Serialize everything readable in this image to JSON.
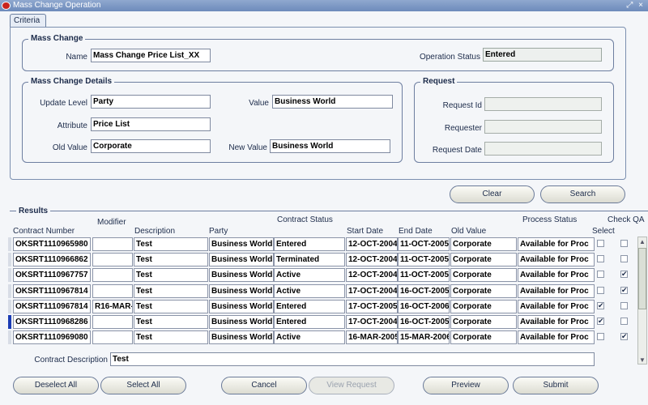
{
  "window": {
    "title": "Mass Change Operation",
    "controls": "⤢ ×"
  },
  "tab": {
    "label": "Criteria"
  },
  "mass_change": {
    "group_label": "Mass Change",
    "name_label": "Name",
    "name_value": "Mass Change Price List_XX",
    "status_label": "Operation Status",
    "status_value": "Entered"
  },
  "details": {
    "group_label": "Mass Change Details",
    "update_level_label": "Update Level",
    "update_level_value": "Party",
    "attribute_label": "Attribute",
    "attribute_value": "Price List",
    "old_value_label": "Old Value",
    "old_value_value": "Corporate",
    "value_label": "Value",
    "value_value": "Business World",
    "new_value_label": "New Value",
    "new_value_value": "Business World"
  },
  "request": {
    "group_label": "Request",
    "id_label": "Request Id",
    "requester_label": "Requester",
    "date_label": "Request Date",
    "id_value": "",
    "requester_value": "",
    "date_value": ""
  },
  "buttons": {
    "clear": "Clear",
    "search": "Search",
    "deselect_all": "Deselect All",
    "select_all": "Select All",
    "cancel": "Cancel",
    "view_request": "View Request",
    "preview": "Preview",
    "submit": "Submit"
  },
  "results": {
    "label": "Results",
    "headers": {
      "contract_number": "Contract Number",
      "modifier": "Modifier",
      "description": "Description",
      "party": "Party",
      "contract_status": "Contract Status",
      "start_date": "Start Date",
      "end_date": "End Date",
      "old_value": "Old Value",
      "process_status": "Process Status",
      "select": "Select",
      "check_qa": "Check QA"
    },
    "rows": [
      {
        "contract": "OKSRT1110965980",
        "modifier": "",
        "description": "Test",
        "party": "Business World",
        "status": "Entered",
        "start": "12-OCT-2004",
        "end": "11-OCT-2005",
        "old_value": "Corporate",
        "process": "Available for Proc",
        "select": false,
        "qa": false
      },
      {
        "contract": "OKSRT1110966862",
        "modifier": "",
        "description": "Test",
        "party": "Business World",
        "status": "Terminated",
        "start": "12-OCT-2004",
        "end": "11-OCT-2005",
        "old_value": "Corporate",
        "process": "Available for Proc",
        "select": false,
        "qa": false
      },
      {
        "contract": "OKSRT1110967757",
        "modifier": "",
        "description": "Test",
        "party": "Business World",
        "status": "Active",
        "start": "12-OCT-2004",
        "end": "11-OCT-2005",
        "old_value": "Corporate",
        "process": "Available for Proc",
        "select": false,
        "qa": true
      },
      {
        "contract": "OKSRT1110967814",
        "modifier": "",
        "description": "Test",
        "party": "Business World",
        "status": "Active",
        "start": "17-OCT-2004",
        "end": "16-OCT-2005",
        "old_value": "Corporate",
        "process": "Available for Proc",
        "select": false,
        "qa": true
      },
      {
        "contract": "OKSRT1110967814",
        "modifier": "R16-MAR-",
        "description": "Test",
        "party": "Business World",
        "status": "Entered",
        "start": "17-OCT-2005",
        "end": "16-OCT-2006",
        "old_value": "Corporate",
        "process": "Available for Proc",
        "select": true,
        "qa": false
      },
      {
        "contract": "OKSRT1110968286",
        "modifier": "",
        "description": "Test",
        "party": "Business World",
        "status": "Entered",
        "start": "17-OCT-2004",
        "end": "16-OCT-2005",
        "old_value": "Corporate",
        "process": "Available for Proc",
        "select": true,
        "qa": false
      },
      {
        "contract": "OKSRT1110969080",
        "modifier": "",
        "description": "Test",
        "party": "Business World",
        "status": "Active",
        "start": "16-MAR-2005",
        "end": "15-MAR-2006",
        "old_value": "Corporate",
        "process": "Available for Proc",
        "select": false,
        "qa": true
      }
    ],
    "contract_description_label": "Contract Description",
    "contract_description_value": "Test"
  }
}
